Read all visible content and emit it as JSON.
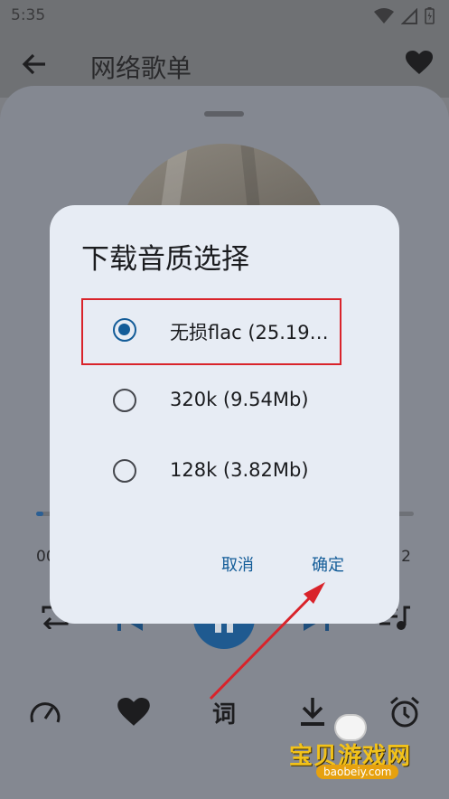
{
  "status_bar": {
    "time": "5:35"
  },
  "app_bar": {
    "title": "网络歌单"
  },
  "player": {
    "progress": 0.02,
    "time_elapsed": "00",
    "time_total": "2"
  },
  "bottom_bar": {
    "lyric_label": "词"
  },
  "dialog": {
    "title": "下载音质选择",
    "options": [
      {
        "label": "无损flac (25.19…",
        "selected": true
      },
      {
        "label": "320k (9.54Mb)",
        "selected": false
      },
      {
        "label": "128k (3.82Mb)",
        "selected": false
      }
    ],
    "cancel_label": "取消",
    "confirm_label": "确定"
  },
  "watermark": {
    "title": "宝贝游戏网",
    "url": "baobeiy.com"
  },
  "colors": {
    "accent": "#135c98",
    "dialog_bg": "#e7ecf4",
    "annotation_red": "#d9232a"
  }
}
